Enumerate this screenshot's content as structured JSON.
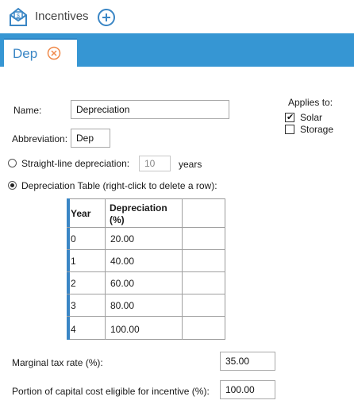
{
  "app": {
    "title": "Incentives"
  },
  "tab": {
    "label": "Dep"
  },
  "form": {
    "name_label": "Name:",
    "name_value": "Depreciation",
    "abbrev_label": "Abbreviation:",
    "abbrev_value": "Dep",
    "applies_label": "Applies to:",
    "applies": [
      {
        "label": "Solar",
        "checked": true
      },
      {
        "label": "Storage",
        "checked": false
      }
    ],
    "straight_line_label": "Straight-line depreciation:",
    "straight_line_value": "10",
    "years_label": "years",
    "table_option_label": "Depreciation Table (right-click to delete a row):",
    "marginal_label": "Marginal tax rate (%):",
    "marginal_value": "35.00",
    "portion_label": "Portion of capital cost eligible for incentive (%):",
    "portion_value": "100.00"
  },
  "table": {
    "headers": {
      "year": "Year",
      "dep_line1": "Depreciation",
      "dep_line2": "(%)"
    },
    "rows": [
      {
        "year": "0",
        "dep": "20.00"
      },
      {
        "year": "1",
        "dep": "40.00"
      },
      {
        "year": "2",
        "dep": "60.00"
      },
      {
        "year": "3",
        "dep": "80.00"
      },
      {
        "year": "4",
        "dep": "100.00"
      }
    ]
  },
  "colors": {
    "accent": "#3696d3",
    "tab_text": "#3a86c5",
    "close": "#f08a4b"
  }
}
